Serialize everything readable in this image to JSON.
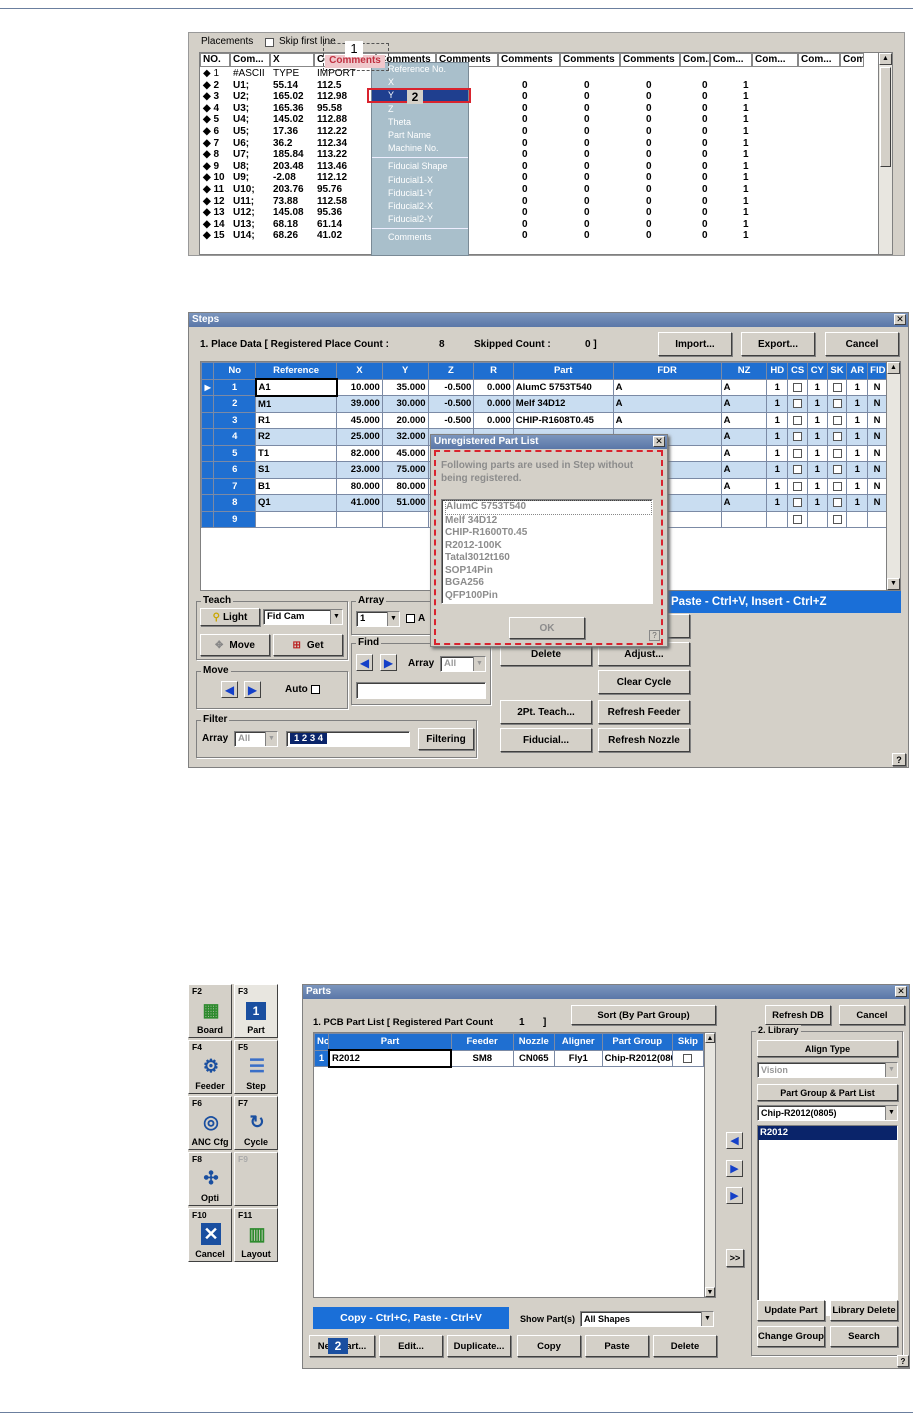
{
  "placements": {
    "title": "Placements",
    "skip_label": "Skip first line",
    "headers": [
      "NO.",
      "Com...",
      "X",
      "Comments",
      "Comments",
      "Comments",
      "Comments",
      "Comments",
      "Comments",
      "Com...",
      "Com...",
      "Com...",
      "Com...",
      "Com"
    ],
    "rows": [
      [
        "◆ 1",
        "#ASCII",
        "TYPE",
        "IMPORT"
      ],
      [
        "◆ 2",
        "U1;",
        "55.14",
        "112.5"
      ],
      [
        "◆ 3",
        "U2;",
        "165.02",
        "112.98"
      ],
      [
        "◆ 4",
        "U3;",
        "165.36",
        "95.58"
      ],
      [
        "◆ 5",
        "U4;",
        "145.02",
        "112.88"
      ],
      [
        "◆ 6",
        "U5;",
        "17.36",
        "112.22"
      ],
      [
        "◆ 7",
        "U6;",
        "36.2",
        "112.34"
      ],
      [
        "◆ 8",
        "U7;",
        "185.84",
        "113.22"
      ],
      [
        "◆ 9",
        "U8;",
        "203.48",
        "113.46"
      ],
      [
        "◆ 10",
        "U9;",
        "-2.08",
        "112.12"
      ],
      [
        "◆ 11",
        "U10;",
        "203.76",
        "95.76"
      ],
      [
        "◆ 12",
        "U11;",
        "73.88",
        "112.58"
      ],
      [
        "◆ 13",
        "U12;",
        "145.08",
        "95.36"
      ],
      [
        "◆ 14",
        "U13;",
        "68.18",
        "61.14"
      ],
      [
        "◆ 15",
        "U14;",
        "68.26",
        "41.02"
      ]
    ],
    "extra_cols": [
      "0",
      "0",
      "0",
      "0",
      "1"
    ],
    "menu": [
      "Reference No.",
      "X",
      "Y",
      "Z",
      "Theta",
      "Part Name",
      "Machine No.",
      "Fiducial Shape",
      "Fiducial1-X",
      "Fiducial1-Y",
      "Fiducial2-X",
      "Fiducial2-Y",
      "Comments"
    ],
    "badge1": "1",
    "badge2": "2"
  },
  "steps": {
    "title": "Steps",
    "place_data": "1. Place Data  [ Registered Place Count :",
    "place_count": "8",
    "skipped_label": "Skipped Count :",
    "skipped_count": "0 ]",
    "import": "Import...",
    "export": "Export...",
    "cancel": "Cancel",
    "headers": [
      "",
      "No",
      "Reference",
      "X",
      "Y",
      "Z",
      "R",
      "Part",
      "FDR",
      "NZ",
      "HD",
      "CS",
      "CY",
      "SK",
      "AR",
      "FID"
    ],
    "rows": [
      {
        "no": "1",
        "ref": "A1",
        "x": "10.000",
        "y": "35.000",
        "z": "-0.500",
        "r": "0.000",
        "part": "AlumC 5753T540",
        "fdr": "A",
        "nz": "A",
        "hd": "1",
        "cy": "1",
        "ar": "1",
        "fid": "N"
      },
      {
        "no": "2",
        "ref": "M1",
        "x": "39.000",
        "y": "30.000",
        "z": "-0.500",
        "r": "0.000",
        "part": "Melf 34D12",
        "fdr": "A",
        "nz": "A",
        "hd": "1",
        "cy": "1",
        "ar": "1",
        "fid": "N"
      },
      {
        "no": "3",
        "ref": "R1",
        "x": "45.000",
        "y": "20.000",
        "z": "-0.500",
        "r": "0.000",
        "part": "CHIP-R1608T0.45",
        "fdr": "A",
        "nz": "A",
        "hd": "1",
        "cy": "1",
        "ar": "1",
        "fid": "N"
      },
      {
        "no": "4",
        "ref": "R2",
        "x": "25.000",
        "y": "32.000",
        "z": "",
        "r": "",
        "part": "",
        "fdr": "",
        "nz": "A",
        "hd": "1",
        "cy": "1",
        "ar": "1",
        "fid": "N"
      },
      {
        "no": "5",
        "ref": "T1",
        "x": "82.000",
        "y": "45.000",
        "z": "",
        "r": "",
        "part": "",
        "fdr": "",
        "nz": "A",
        "hd": "1",
        "cy": "1",
        "ar": "1",
        "fid": "N"
      },
      {
        "no": "6",
        "ref": "S1",
        "x": "23.000",
        "y": "75.000",
        "z": "",
        "r": "",
        "part": "",
        "fdr": "",
        "nz": "A",
        "hd": "1",
        "cy": "1",
        "ar": "1",
        "fid": "N"
      },
      {
        "no": "7",
        "ref": "B1",
        "x": "80.000",
        "y": "80.000",
        "z": "",
        "r": "",
        "part": "",
        "fdr": "",
        "nz": "A",
        "hd": "1",
        "cy": "1",
        "ar": "1",
        "fid": "N"
      },
      {
        "no": "8",
        "ref": "Q1",
        "x": "41.000",
        "y": "51.000",
        "z": "",
        "r": "",
        "part": "",
        "fdr": "",
        "nz": "A",
        "hd": "1",
        "cy": "1",
        "ar": "1",
        "fid": "N"
      },
      {
        "no": "9",
        "ref": "",
        "x": "",
        "y": "",
        "z": "",
        "r": "",
        "part": "",
        "fdr": "",
        "nz": "",
        "hd": "",
        "cy": "",
        "ar": "",
        "fid": ""
      }
    ],
    "teach": "Teach",
    "light": "Light",
    "fidcam": "Fid Cam",
    "move_btn": "Move",
    "get_btn": "Get",
    "move_group": "Move",
    "auto": "Auto",
    "array_group": "Array",
    "array_value": "1",
    "array_a": "A",
    "find_group": "Find",
    "find_array": "Array",
    "find_all": "All",
    "filter_group": "Filter",
    "filter_array": "Array",
    "filter_all": "All",
    "filter_value": "1  2  3  4",
    "filtering": "Filtering",
    "delete": "Delete",
    "adjust": "Adjust...",
    "clear_cycle": "Clear Cycle",
    "pt_teach": "2Pt. Teach...",
    "refresh_feeder": "Refresh Feeder",
    "fiducial": "Fiducial...",
    "refresh_nozzle": "Refresh Nozzle",
    "paste_hint": "Paste - Ctrl+V,  Insert - Ctrl+Z",
    "help": "?",
    "dialog": {
      "title": "Unregistered Part List",
      "message": "Following parts are used in Step without being registered.",
      "parts": [
        "AlumC 5753T540",
        "Melf 34D12",
        "CHIP-R1600T0.45",
        "R2012-100K",
        "Tatal3012t160",
        "SOP14Pin",
        "BGA256",
        "QFP100Pin"
      ],
      "ok": "OK"
    }
  },
  "fkeys": [
    {
      "key": "F2",
      "label": "Board"
    },
    {
      "key": "F3",
      "label": "Part"
    },
    {
      "key": "F4",
      "label": "Feeder"
    },
    {
      "key": "F5",
      "label": "Step"
    },
    {
      "key": "F6",
      "label": "ANC Cfg"
    },
    {
      "key": "F7",
      "label": "Cycle"
    },
    {
      "key": "F8",
      "label": "Opti"
    },
    {
      "key": "F9",
      "label": ""
    },
    {
      "key": "F10",
      "label": "Cancel"
    },
    {
      "key": "F11",
      "label": "Layout"
    }
  ],
  "fkey_badge": "1",
  "parts": {
    "title": "Parts",
    "pcb_label": "1. PCB Part List   [ Registered Part Count",
    "pcb_count": "1",
    "pcb_close": "]",
    "sort": "Sort (By Part Group)",
    "refresh_db": "Refresh DB",
    "cancel": "Cancel",
    "headers": [
      "No",
      "Part",
      "Feeder",
      "Nozzle",
      "Aligner",
      "Part Group",
      "Skip"
    ],
    "row": {
      "no": "1",
      "part": "R2012",
      "feeder": "SM8",
      "nozzle": "CN065",
      "aligner": "Fly1",
      "group": "Chip-R2012(0805)"
    },
    "copy_hint": "Copy - Ctrl+C,  Paste - Ctrl+V",
    "show_parts": "Show Part(s)",
    "all_shapes": "All Shapes",
    "new_part": "New Part...",
    "badge": "2",
    "edit": "Edit...",
    "duplicate": "Duplicate...",
    "copy": "Copy",
    "paste": "Paste",
    "delete": "Delete",
    "library": "2. Library",
    "align_type": "Align Type",
    "vision": "Vision",
    "pg_pl": "Part Group & Part List",
    "group_value": "Chip-R2012(0805)",
    "lib_item": "R2012",
    "update_part": "Update Part",
    "library_delete": "Library Delete",
    "change_group": "Change Group",
    "search": "Search",
    "more": ">>",
    "help": "?"
  }
}
